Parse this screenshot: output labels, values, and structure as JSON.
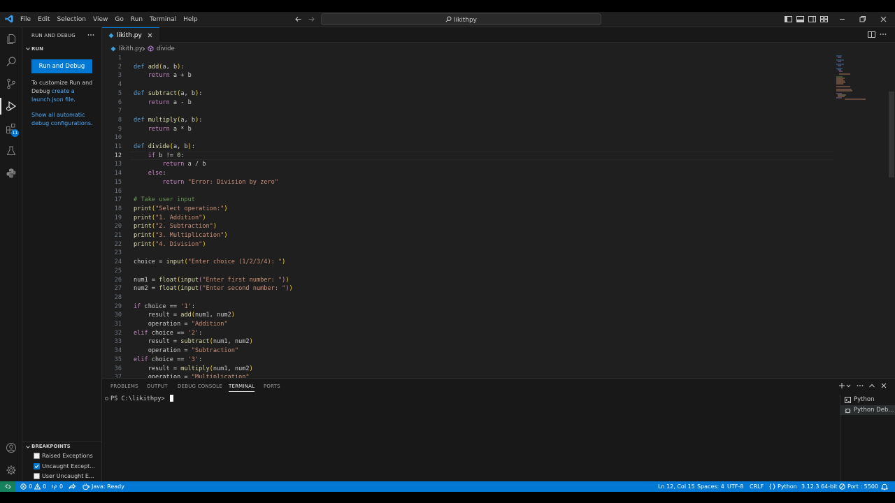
{
  "menu": [
    "File",
    "Edit",
    "Selection",
    "View",
    "Go",
    "Run",
    "Terminal",
    "Help"
  ],
  "command_center": "likithpy",
  "sidebar": {
    "title": "RUN AND DEBUG",
    "run_section": "RUN",
    "run_button": "Run and Debug",
    "customize_1": "To customize Run and",
    "customize_2": "Debug ",
    "customize_link_1": "create a",
    "customize_link_2": "launch.json file",
    "customize_end": ".",
    "show_all_1": "Show all automatic",
    "show_all_2": "debug configurations",
    "show_all_end": ".",
    "breakpoints_title": "BREAKPOINTS",
    "breakpoints": [
      {
        "label": "Raised Exceptions",
        "checked": false
      },
      {
        "label": "Uncaught Except...",
        "checked": true
      },
      {
        "label": "User Uncaught E...",
        "checked": false
      }
    ]
  },
  "activity_badge": "11",
  "editor": {
    "tab_label": "likith.py",
    "breadcrumb_file": "likith.py",
    "breadcrumb_symbol": "divide",
    "current_line": 12
  },
  "panel": {
    "tabs": [
      "PROBLEMS",
      "OUTPUT",
      "DEBUG CONSOLE",
      "TERMINAL",
      "PORTS"
    ],
    "active_tab": "TERMINAL",
    "prompt": "PS C:\\likithpy>",
    "terminals": [
      "Python",
      "Python Deb..."
    ]
  },
  "status": {
    "errors": "0",
    "warnings": "0",
    "ports": "0",
    "java": "Java: Ready",
    "position": "Ln 12, Col 15",
    "spaces": "Spaces: 4",
    "encoding": "UTF-8",
    "eol": "CRLF",
    "language": "Python",
    "interpreter": "3.12.3 64-bit",
    "port": "Port : 5500"
  },
  "colors": {
    "accent": "#0078d4",
    "keyword": "#569cd6",
    "control": "#c586c0",
    "function": "#dcdcaa",
    "string": "#ce9178",
    "comment": "#6a9955"
  }
}
